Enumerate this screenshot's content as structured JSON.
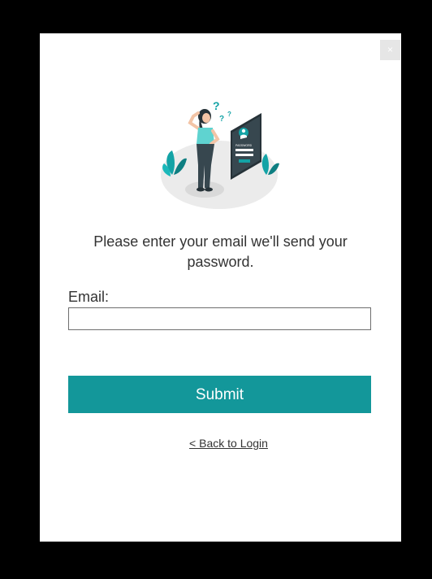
{
  "dialog": {
    "close_label": "×"
  },
  "illustration": {
    "icon": "forgot-password-illustration",
    "panel_text": "PASSWORD"
  },
  "form": {
    "message": "Please enter your email we'll send your password.",
    "email_label": "Email:",
    "email_value": "",
    "email_placeholder": "",
    "submit_label": "Submit",
    "back_link_label": "< Back to Login"
  },
  "colors": {
    "accent": "#13979a",
    "text": "#333333",
    "backdrop": "#000000",
    "close_bg": "#e6e6e6"
  }
}
